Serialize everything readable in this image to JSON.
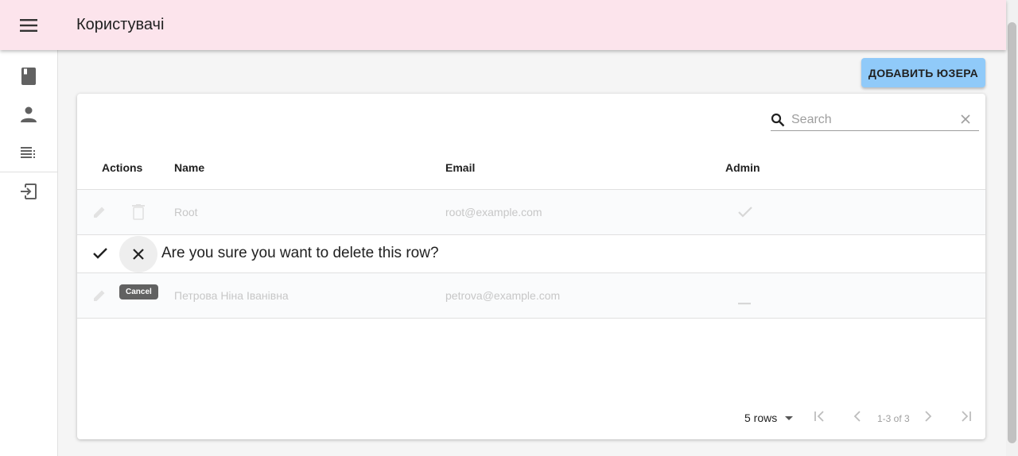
{
  "app": {
    "title": "Користувачі",
    "menu_icon": "menu-icon"
  },
  "sidebar": {
    "items": [
      {
        "icon": "book-icon",
        "label": ""
      },
      {
        "icon": "person-icon",
        "label": ""
      },
      {
        "icon": "list-icon",
        "label": ""
      },
      {
        "icon": "logout-icon",
        "label": ""
      }
    ]
  },
  "toolbar": {
    "add_label": "ДОБАВИТЬ ЮЗЕРА"
  },
  "search": {
    "placeholder": "Search",
    "value": ""
  },
  "table": {
    "headers": {
      "actions": "Actions",
      "name": "Name",
      "email": "Email",
      "admin": "Admin"
    },
    "rows": [
      {
        "name": "Root",
        "email": "root@example.com",
        "admin": true
      },
      {
        "name": "Петрова Ніна Іванівна",
        "email": "petrova@example.com",
        "admin": false
      }
    ],
    "confirm_row": {
      "message": "Are you sure you want to delete this row?",
      "cancel_tooltip": "Cancel"
    }
  },
  "pagination": {
    "rows_label": "5 rows",
    "range": "1-3 of 3"
  },
  "colors": {
    "appbar": "#fce4ec",
    "primary_button": "#90caf9"
  }
}
